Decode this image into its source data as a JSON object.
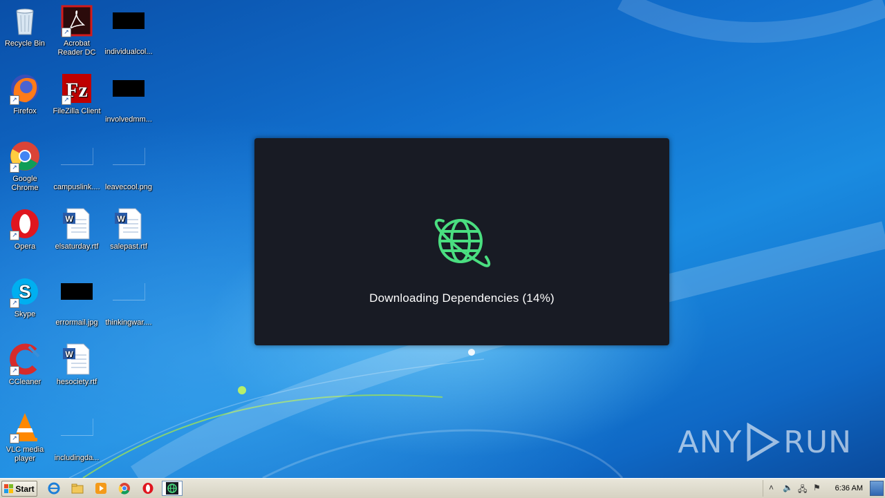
{
  "desktop_icons": [
    {
      "label": "Recycle Bin",
      "icon": "recycle-bin-icon"
    },
    {
      "label": "Acrobat Reader DC",
      "icon": "acrobat-icon"
    },
    {
      "label": "individualcol...",
      "icon": "black-file-thumbnail"
    },
    {
      "label": "Firefox",
      "icon": "firefox-icon"
    },
    {
      "label": "FileZilla Client",
      "icon": "filezilla-icon"
    },
    {
      "label": "involvedmm...",
      "icon": "black-file-thumbnail"
    },
    {
      "label": "Google Chrome",
      "icon": "chrome-icon"
    },
    {
      "label": "campuslink....",
      "icon": "blank-file-thumbnail"
    },
    {
      "label": "leavecool.png",
      "icon": "blank-file-thumbnail"
    },
    {
      "label": "Opera",
      "icon": "opera-icon"
    },
    {
      "label": "elsaturday.rtf",
      "icon": "word-document-icon"
    },
    {
      "label": "salepast.rtf",
      "icon": "word-document-icon"
    },
    {
      "label": "Skype",
      "icon": "skype-icon"
    },
    {
      "label": "errormail.jpg",
      "icon": "black-file-thumbnail"
    },
    {
      "label": "thinkingwar....",
      "icon": "blank-file-thumbnail"
    },
    {
      "label": "CCleaner",
      "icon": "ccleaner-icon"
    },
    {
      "label": "hesociety.rtf",
      "icon": "word-document-icon"
    },
    {
      "label": "VLC media player",
      "icon": "vlc-icon"
    },
    {
      "label": "includingda...",
      "icon": "blank-file-thumbnail"
    }
  ],
  "dialog": {
    "status": "Downloading Dependencies (14%)",
    "icon": "globe-icon",
    "accent": "#4ade80",
    "background": "#181b24"
  },
  "watermark": {
    "left": "ANY",
    "right": "RUN"
  },
  "taskbar": {
    "start_label": "Start",
    "pinned": [
      "internet-explorer-icon",
      "file-explorer-icon",
      "media-player-icon",
      "chrome-icon",
      "opera-icon",
      "globe-app-icon"
    ],
    "clock": "6:36 AM"
  }
}
